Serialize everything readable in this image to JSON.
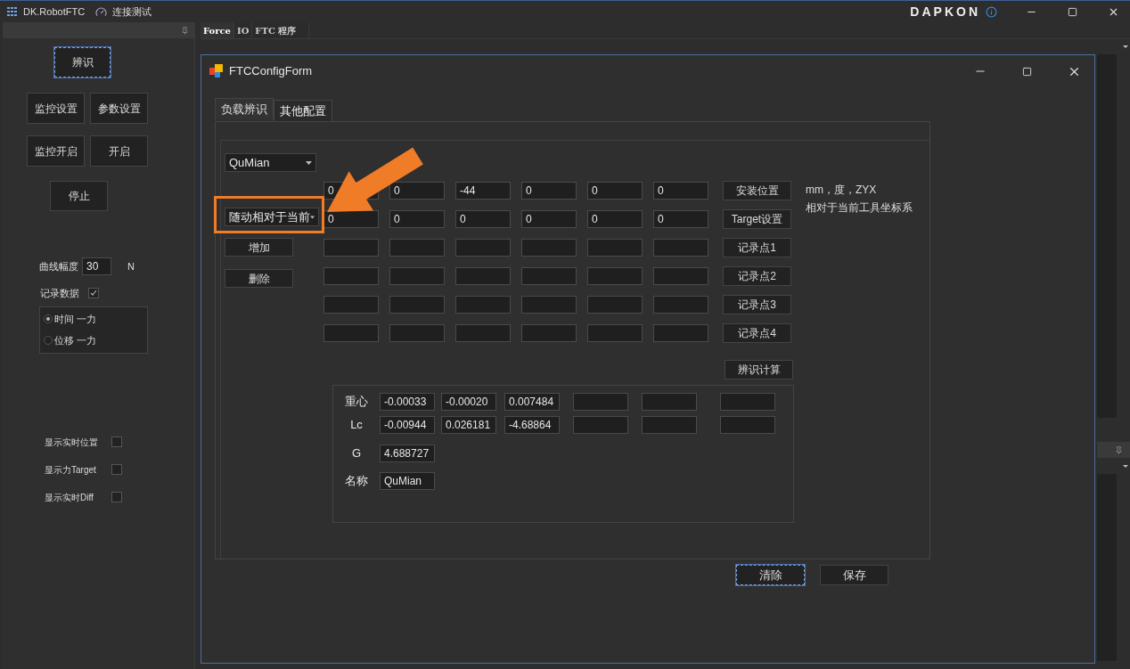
{
  "app": {
    "title": "DK.RobotFTC",
    "menu_item": "连接测试",
    "logo": "DAPKON"
  },
  "left_panel": {
    "buttons": [
      {
        "label": "辨识",
        "focused": true
      },
      {
        "label": "监控设置",
        "focused": false
      },
      {
        "label": "参数设置",
        "focused": false
      },
      {
        "label": "监控开启",
        "focused": false
      },
      {
        "label": "开启",
        "focused": false
      },
      {
        "label": "停止",
        "focused": false
      }
    ],
    "amplitude": {
      "label": "曲线幅度",
      "value": "30",
      "unit": "N"
    },
    "record": {
      "label": "记录数据",
      "checked": true
    },
    "modes": [
      {
        "label": "时间 一力",
        "selected": true
      },
      {
        "label": "位移 一力",
        "selected": false
      }
    ],
    "display_options": [
      {
        "label": "显示实时位置",
        "checked": false
      },
      {
        "label": "显示力Target",
        "checked": false
      },
      {
        "label": "显示实时Diff",
        "checked": false
      }
    ]
  },
  "doc_tabs": [
    {
      "label": "Force",
      "selected": true
    },
    {
      "label": "IO",
      "selected": false
    },
    {
      "label": "FTC 程序",
      "selected": false
    }
  ],
  "dialog": {
    "title": "FTCConfigForm",
    "tabs": [
      {
        "label": "负载辨识",
        "selected": true
      },
      {
        "label": "其他配置",
        "selected": false
      }
    ],
    "load_select": "QuMian",
    "frame_select": "随动相对于当前",
    "side_buttons": [
      "增加",
      "删除"
    ],
    "grid_rows": [
      {
        "values": [
          "0",
          "0",
          "-44",
          "0",
          "0",
          "0"
        ],
        "button": "安装位置"
      },
      {
        "values": [
          "0",
          "0",
          "0",
          "0",
          "0",
          "0"
        ],
        "button": "Target设置"
      },
      {
        "values": [],
        "button": "记录点1"
      },
      {
        "values": [],
        "button": "记录点2"
      },
      {
        "values": [],
        "button": "记录点3"
      },
      {
        "values": [],
        "button": "记录点4"
      }
    ],
    "notes": [
      "mm，度，ZYX",
      "相对于当前工具坐标系"
    ],
    "calc_button": "辨识计算",
    "results": [
      {
        "label": "重心",
        "kind": "vector",
        "values": [
          "-0.00033",
          "-0.00020",
          "0.007484"
        ]
      },
      {
        "label": "Lc",
        "kind": "vector",
        "values": [
          "-0.00944",
          "0.026181",
          "-4.68864"
        ]
      },
      {
        "label": "G",
        "kind": "scalar",
        "values": [
          "4.688727"
        ]
      },
      {
        "label": "名称",
        "kind": "scalar",
        "values": [
          "QuMian"
        ]
      }
    ],
    "footer_buttons": [
      {
        "label": "清除",
        "focused": true
      },
      {
        "label": "保存",
        "focused": false
      }
    ]
  }
}
